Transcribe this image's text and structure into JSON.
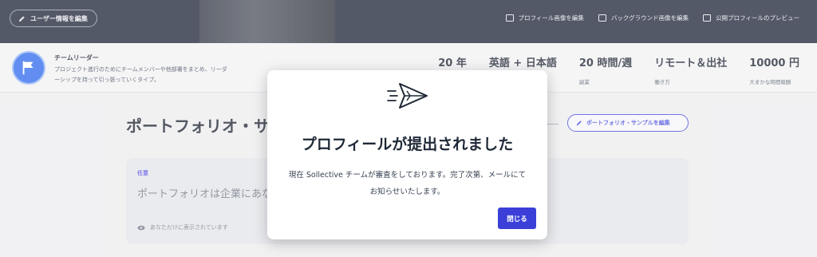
{
  "header": {
    "edit_user_label": "ユーザー情報を編集",
    "actions": [
      {
        "label": "プロフィール画像を編集",
        "icon": "camera-icon"
      },
      {
        "label": "バックグラウンド画像を編集",
        "icon": "image-icon"
      },
      {
        "label": "公開プロフィールのプレビュー",
        "icon": "preview-icon"
      }
    ]
  },
  "profile": {
    "name": "チームリーダー",
    "description": "プロジェクト進行のためにチームメンバーや他部署をまとめ、リーダーシップを持って引っ張っていくタイプ。",
    "stats": [
      {
        "value": "20 年",
        "label": ""
      },
      {
        "value": "英語 + 日本語",
        "label": ""
      },
      {
        "value": "20 時間/週",
        "label": "副業"
      },
      {
        "value": "リモート＆出社",
        "label": "働き方"
      },
      {
        "value": "10000 円",
        "label": "大まかな時間報酬"
      }
    ]
  },
  "portfolio": {
    "title": "ポートフォリオ・サ",
    "edit_label": "ポートフォリオ・サンプルを編集",
    "badge": "任意",
    "text": "ポートフォリオは企業にあな                                        の目に留まるプロフィールを作りましょう。",
    "visibility": "あなただけに表示されています"
  },
  "modal": {
    "title": "プロフィールが提出されました",
    "body": "現在 Sollective チームが審査をしております。完了次第、メールにてお知らせいたします。",
    "close_label": "閉じる"
  },
  "colors": {
    "accent": "#3b3fd8",
    "header_bg": "#121a2e",
    "avatar": "#2563eb"
  }
}
